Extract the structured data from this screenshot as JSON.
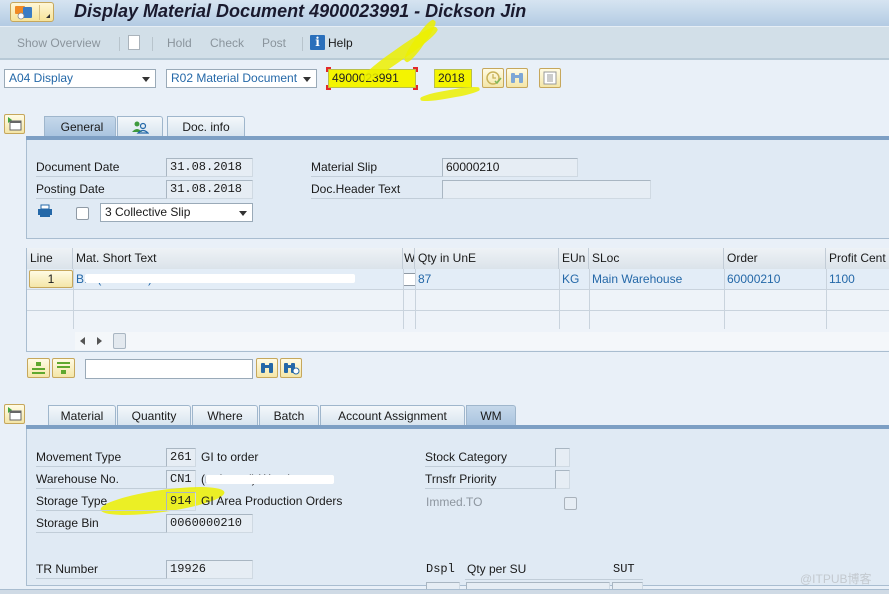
{
  "window": {
    "title": "Display Material Document 4900023991 - Dickson Jin"
  },
  "toolbar": {
    "show_overview": "Show Overview",
    "hold": "Hold",
    "check": "Check",
    "post": "Post",
    "help": "Help"
  },
  "selection": {
    "action": "A04 Display",
    "reference": "R02 Material Document",
    "document_number": "4900023991",
    "year": "2018"
  },
  "header_tabs": {
    "tabs": [
      {
        "label": "General",
        "active": true
      },
      {
        "label": "",
        "icon": "partner-icon",
        "active": false
      },
      {
        "label": "Doc. info",
        "active": false
      }
    ]
  },
  "general": {
    "document_date_label": "Document Date",
    "document_date": "31.08.2018",
    "posting_date_label": "Posting Date",
    "posting_date": "31.08.2018",
    "material_slip_label": "Material Slip",
    "material_slip": "60000210",
    "doc_header_text_label": "Doc.Header Text",
    "doc_header_text": "",
    "print_version": "3 Collective Slip",
    "print_checked": false
  },
  "items_table": {
    "columns": [
      "Line",
      "Mat. Short Text",
      "W",
      "Qty in UnE",
      "EUn",
      "SLoc",
      "Order",
      "Profit Cent"
    ],
    "rows": [
      {
        "line": "1",
        "mat_short_text": "B... (redacted)",
        "w_checked": false,
        "qty": "87",
        "eun": "KG",
        "sloc": "Main Warehouse",
        "order": "60000210",
        "profit_center": "1100"
      }
    ],
    "search_value": ""
  },
  "item_tabs": {
    "tabs": [
      {
        "label": "Material",
        "active": false
      },
      {
        "label": "Quantity",
        "active": false
      },
      {
        "label": "Where",
        "active": false
      },
      {
        "label": "Batch",
        "active": false
      },
      {
        "label": "Account Assignment",
        "active": false
      },
      {
        "label": "WM",
        "active": true
      }
    ]
  },
  "wm": {
    "movement_type_label": "Movement Type",
    "movement_type": "261",
    "movement_type_text": "GI to order",
    "warehouse_no_label": "Warehouse No.",
    "warehouse_no": "CN1",
    "warehouse_text": "(redacted) Warehouse",
    "storage_type_label": "Storage Type",
    "storage_type": "914",
    "storage_type_text": "GI Area Production Orders",
    "storage_bin_label": "Storage Bin",
    "storage_bin": "0060000210",
    "tr_number_label": "TR Number",
    "tr_number": "19926",
    "stock_category_label": "Stock Category",
    "stock_category": "",
    "transfer_priority_label": "Trnsfr Priority",
    "transfer_priority": "",
    "immed_to_label": "Immed.TO",
    "immed_to_checked": false,
    "dspl_label": "Dspl",
    "qty_per_su_label": "Qty per SU",
    "sut_label": "SUT"
  },
  "watermark": "@ITPUB博客",
  "colors": {
    "accent_link": "#2468a8",
    "highlight": "#f4f400",
    "title_bar": "#b3cbe3"
  }
}
